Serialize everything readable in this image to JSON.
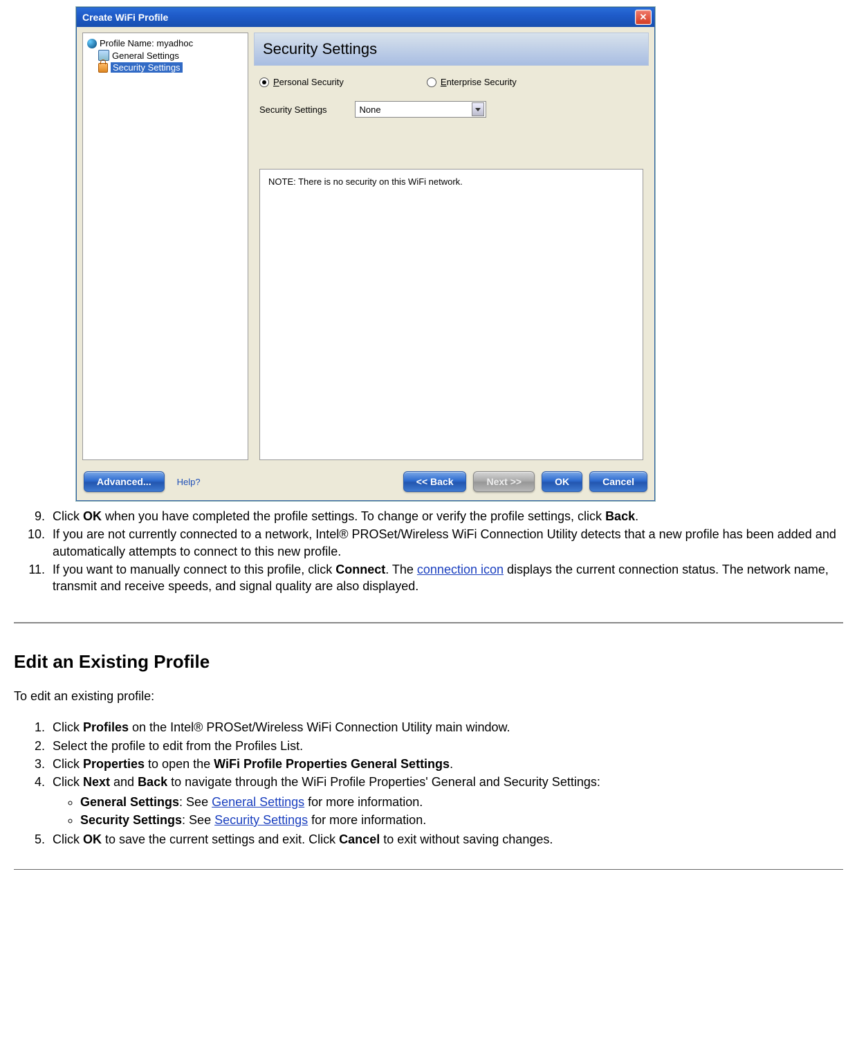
{
  "dialog": {
    "title": "Create WiFi Profile",
    "tree": {
      "profile_label": "Profile Name: myadhoc",
      "general_label": "General Settings",
      "security_label": "Security Settings"
    },
    "panel_header": "Security Settings",
    "radios": {
      "personal": "Personal Security",
      "enterprise": "Enterprise Security"
    },
    "settings_label": "Security Settings",
    "select_value": "None",
    "note_text": "NOTE: There is no security on this WiFi network.",
    "buttons": {
      "advanced": "Advanced...",
      "help": "Help?",
      "back": "<< Back",
      "next": "Next >>",
      "ok": "OK",
      "cancel": "Cancel"
    }
  },
  "doc": {
    "steps_a": {
      "s9_a": "Click ",
      "s9_b": "OK",
      "s9_c": " when you have completed the profile settings. To change or verify the profile settings, click ",
      "s9_d": "Back",
      "s9_e": ".",
      "s10": "If you are not currently connected to a network, Intel® PROSet/Wireless WiFi Connection Utility detects that a new profile has been added and automatically attempts to connect to this new profile.",
      "s11_a": "If you want to manually connect to this profile, click ",
      "s11_b": "Connect",
      "s11_c": ". The ",
      "s11_link": "connection icon",
      "s11_d": " displays the current connection status. The network name, transmit and receive speeds, and signal quality are also displayed."
    },
    "section_title": "Edit an Existing Profile",
    "intro": "To edit an existing profile:",
    "steps_b": {
      "s1_a": "Click ",
      "s1_b": "Profiles",
      "s1_c": " on the Intel® PROSet/Wireless WiFi Connection Utility main window.",
      "s2": "Select the profile to edit from the Profiles List.",
      "s3_a": "Click ",
      "s3_b": "Properties",
      "s3_c": " to open the ",
      "s3_d": "WiFi Profile Properties General Settings",
      "s3_e": ".",
      "s4_a": "Click ",
      "s4_b": "Next",
      "s4_c": " and ",
      "s4_d": "Back",
      "s4_e": " to navigate through the WiFi Profile Properties' General and Security Settings:",
      "s4_sub1_a": "General Settings",
      "s4_sub1_b": ": See ",
      "s4_sub1_link": "General Settings",
      "s4_sub1_c": " for more information.",
      "s4_sub2_a": "Security Settings",
      "s4_sub2_b": ": See ",
      "s4_sub2_link": "Security Settings",
      "s4_sub2_c": " for more information.",
      "s5_a": "Click ",
      "s5_b": "OK",
      "s5_c": " to save the current settings and exit. Click ",
      "s5_d": "Cancel",
      "s5_e": " to exit without saving changes."
    }
  }
}
